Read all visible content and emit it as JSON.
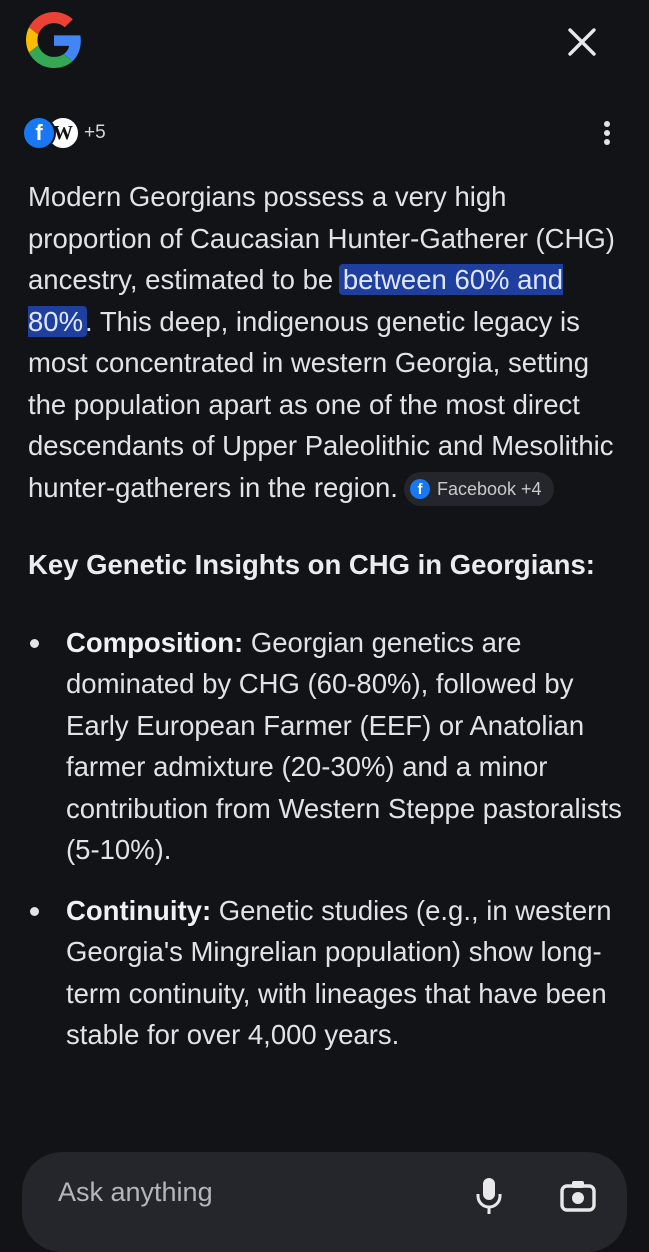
{
  "header": {
    "logo_icon": "google-g-logo",
    "close_icon": "close-icon"
  },
  "sources": {
    "facebook_glyph": "f",
    "wikipedia_glyph": "W",
    "more_count": "+5",
    "menu_icon": "more-vert-icon"
  },
  "answer": {
    "para_before": "Modern Georgians possess a very high proportion of Caucasian Hunter-Gatherer (CHG) ancestry, estimated to be ",
    "para_highlight": "between 60% and 80%",
    "para_after": ". This deep, indigenous genetic legacy is most concentrated in western Georgia, setting the population apart as one of the most direct descendants of Upper Paleolithic and Mesolithic hunter-gatherers in the region.",
    "citation_chip": "Facebook +4",
    "heading": "Key Genetic Insights on CHG in Georgians:",
    "bullets": [
      {
        "title": "Composition:",
        "text": " Georgian genetics are dominated by CHG (60-80%), followed by Early European Farmer (EEF) or Anatolian farmer admixture (20-30%) and a minor contribution from Western Steppe pastoralists (5-10%)."
      },
      {
        "title": "Continuity:",
        "text": " Genetic studies (e.g., in western Georgia's Mingrelian population) show long-term continuity, with lineages that have been stable for over 4,000 years."
      }
    ]
  },
  "ask_bar": {
    "placeholder": "Ask anything",
    "mic_icon": "mic-icon",
    "camera_icon": "camera-icon"
  },
  "colors": {
    "background": "#121317",
    "highlight": "#1f3f9e",
    "facebook": "#1877f2"
  }
}
